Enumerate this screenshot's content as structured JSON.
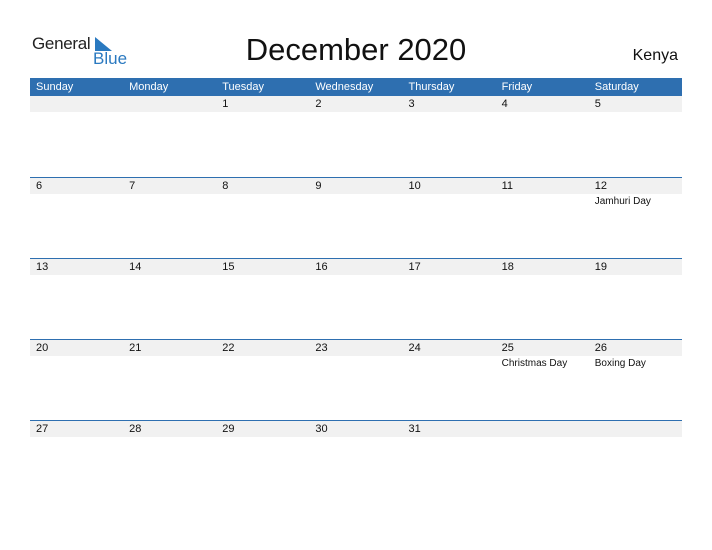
{
  "logo": {
    "general": "General",
    "blue": "Blue"
  },
  "title": "December 2020",
  "country": "Kenya",
  "colors": {
    "accent": "#2e6fb0",
    "row_bg": "#f1f1f1"
  },
  "weekdays": [
    "Sunday",
    "Monday",
    "Tuesday",
    "Wednesday",
    "Thursday",
    "Friday",
    "Saturday"
  ],
  "weeks": [
    {
      "days": [
        "",
        "",
        "1",
        "2",
        "3",
        "4",
        "5"
      ],
      "events": [
        "",
        "",
        "",
        "",
        "",
        "",
        ""
      ]
    },
    {
      "days": [
        "6",
        "7",
        "8",
        "9",
        "10",
        "11",
        "12"
      ],
      "events": [
        "",
        "",
        "",
        "",
        "",
        "",
        "Jamhuri Day"
      ]
    },
    {
      "days": [
        "13",
        "14",
        "15",
        "16",
        "17",
        "18",
        "19"
      ],
      "events": [
        "",
        "",
        "",
        "",
        "",
        "",
        ""
      ]
    },
    {
      "days": [
        "20",
        "21",
        "22",
        "23",
        "24",
        "25",
        "26"
      ],
      "events": [
        "",
        "",
        "",
        "",
        "",
        "Christmas Day",
        "Boxing Day"
      ]
    },
    {
      "days": [
        "27",
        "28",
        "29",
        "30",
        "31",
        "",
        ""
      ],
      "events": [
        "",
        "",
        "",
        "",
        "",
        "",
        ""
      ]
    }
  ]
}
